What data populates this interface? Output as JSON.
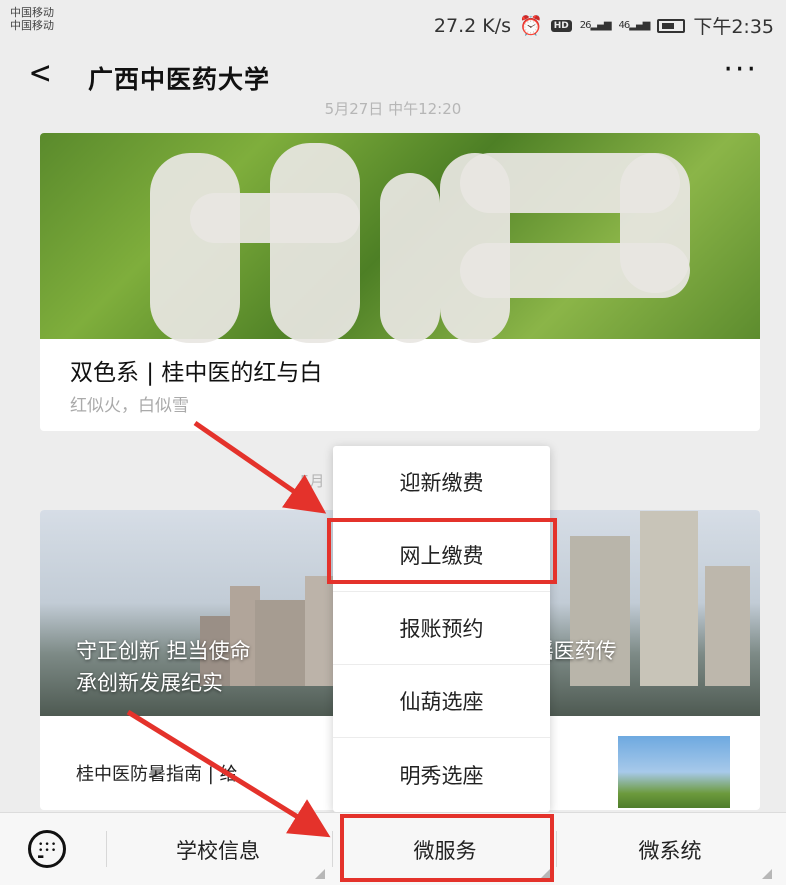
{
  "status": {
    "carrier1": "中国移动",
    "carrier2": "中国移动",
    "speed": "27.2 K/s",
    "hd": "HD",
    "sig1": "26",
    "sig2": "46",
    "time": "下午2:35"
  },
  "nav": {
    "back": "<",
    "title": "广西中医药大学",
    "more": "···"
  },
  "feed": {
    "timestamp1": "5月27日 中午12:20",
    "card1": {
      "title": "双色系 | 桂中医的红与白",
      "subtitle": "红似火，白似雪"
    },
    "timestamp2": "5月",
    "card2": {
      "caption_line1": "守正创新 担当使命",
      "caption_line1b": "药壮瑶医药传",
      "caption_line2": "承创新发展纪实",
      "row_title": "桂中医防暑指南 | 给"
    }
  },
  "popup": {
    "items": [
      "迎新缴费",
      "网上缴费",
      "报账预约",
      "仙葫选座",
      "明秀选座"
    ],
    "highlighted": "网上缴费"
  },
  "bottom": {
    "menu1": "学校信息",
    "menu2": "微服务",
    "menu3": "微系统",
    "highlighted": "微服务"
  },
  "colors": {
    "highlight": "#e4322b",
    "arrow": "#e4322b",
    "background": "#ededed"
  }
}
